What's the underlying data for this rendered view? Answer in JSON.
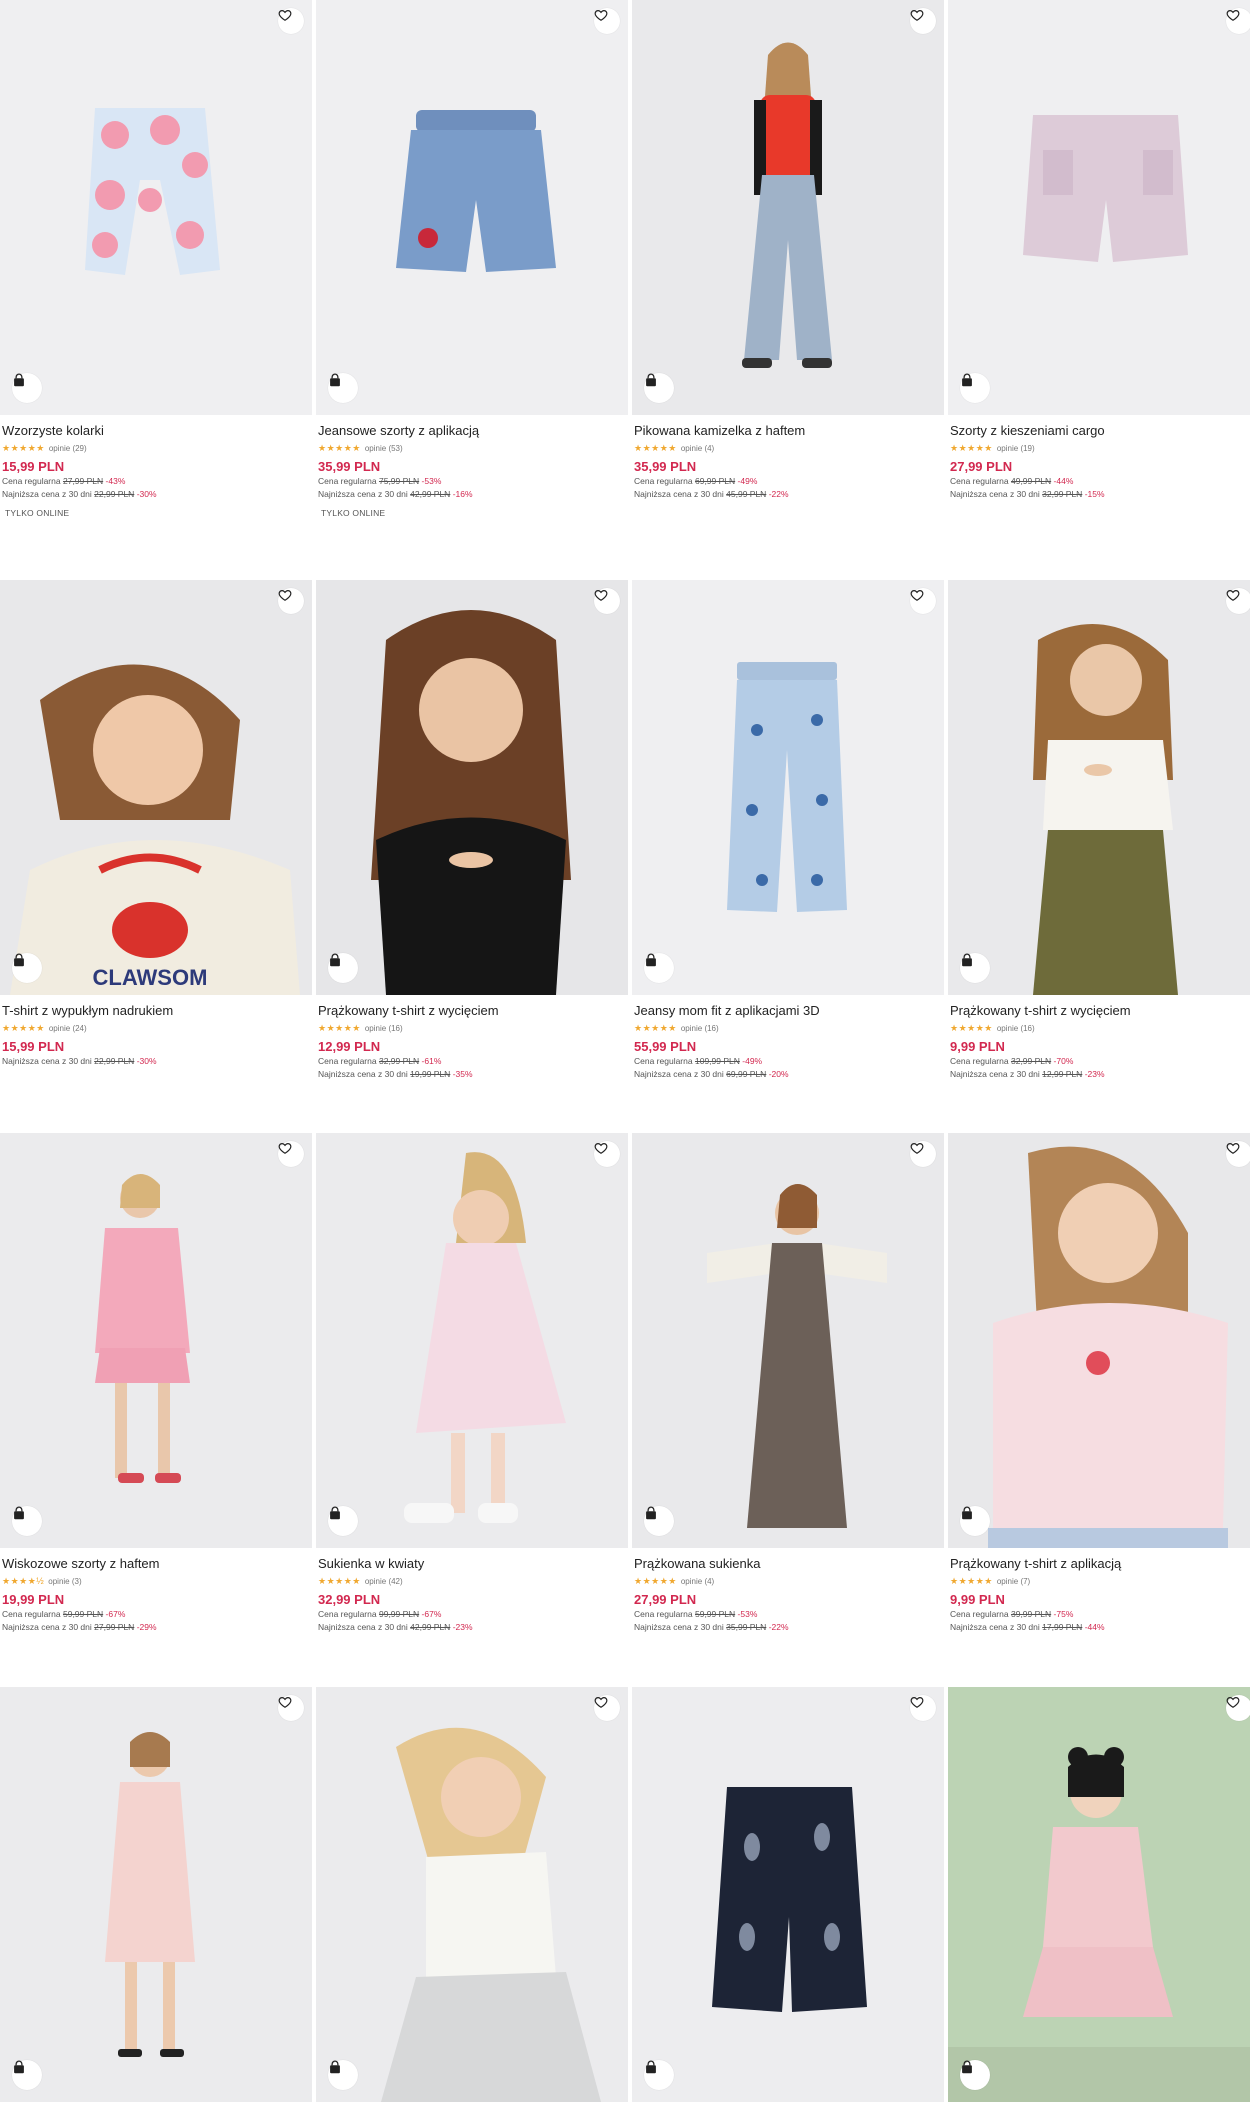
{
  "reviews_prefix": "opinie",
  "products": [
    {
      "title": "Wzorzyste kolarki",
      "stars": "★★★★★",
      "reviews": "(29)",
      "price": "15,99 PLN",
      "regular_label": "Cena regularna",
      "regular_old": "27,99 PLN",
      "regular_disc": "-43%",
      "lowest_label": "Najniższa cena z 30 dni",
      "lowest_old": "22,99 PLN",
      "lowest_disc": "-30%",
      "badge": "TYLKO ONLINE",
      "bg": "#efeff1"
    },
    {
      "title": "Jeansowe szorty z aplikacją",
      "stars": "★★★★★",
      "reviews": "(53)",
      "price": "35,99 PLN",
      "regular_label": "Cena regularna",
      "regular_old": "75,99 PLN",
      "regular_disc": "-53%",
      "lowest_label": "Najniższa cena z 30 dni",
      "lowest_old": "42,99 PLN",
      "lowest_disc": "-16%",
      "badge": "TYLKO ONLINE",
      "bg": "#efeff1"
    },
    {
      "title": "Pikowana kamizelka z haftem",
      "stars": "★★★★★",
      "reviews": "(4)",
      "price": "35,99 PLN",
      "regular_label": "Cena regularna",
      "regular_old": "69,99 PLN",
      "regular_disc": "-49%",
      "lowest_label": "Najniższa cena z 30 dni",
      "lowest_old": "45,99 PLN",
      "lowest_disc": "-22%",
      "badge": "",
      "bg": "#e9e9eb"
    },
    {
      "title": "Szorty z kieszeniami cargo",
      "stars": "★★★★★",
      "reviews": "(19)",
      "price": "27,99 PLN",
      "regular_label": "Cena regularna",
      "regular_old": "49,99 PLN",
      "regular_disc": "-44%",
      "lowest_label": "Najniższa cena z 30 dni",
      "lowest_old": "32,99 PLN",
      "lowest_disc": "-15%",
      "badge": "",
      "bg": "#efeff1"
    },
    {
      "title": "T-shirt z wypukłym nadrukiem",
      "stars": "★★★★★",
      "reviews": "(24)",
      "price": "15,99 PLN",
      "regular_label": "",
      "regular_old": "",
      "regular_disc": "",
      "lowest_label": "Najniższa cena z 30 dni",
      "lowest_old": "22,99 PLN",
      "lowest_disc": "-30%",
      "badge": "",
      "bg": "#e8e8ea"
    },
    {
      "title": "Prążkowany t-shirt z wycięciem",
      "stars": "★★★★★",
      "reviews": "(16)",
      "price": "12,99 PLN",
      "regular_label": "Cena regularna",
      "regular_old": "32,99 PLN",
      "regular_disc": "-61%",
      "lowest_label": "Najniższa cena z 30 dni",
      "lowest_old": "19,99 PLN",
      "lowest_disc": "-35%",
      "badge": "",
      "bg": "#e6e6e8"
    },
    {
      "title": "Jeansy mom fit z aplikacjami 3D",
      "stars": "★★★★★",
      "reviews": "(16)",
      "price": "55,99 PLN",
      "regular_label": "Cena regularna",
      "regular_old": "109,99 PLN",
      "regular_disc": "-49%",
      "lowest_label": "Najniższa cena z 30 dni",
      "lowest_old": "69,99 PLN",
      "lowest_disc": "-20%",
      "badge": "",
      "bg": "#efeff1"
    },
    {
      "title": "Prążkowany t-shirt z wycięciem",
      "stars": "★★★★★",
      "reviews": "(16)",
      "price": "9,99 PLN",
      "regular_label": "Cena regularna",
      "regular_old": "32,99 PLN",
      "regular_disc": "-70%",
      "lowest_label": "Najniższa cena z 30 dni",
      "lowest_old": "12,99 PLN",
      "lowest_disc": "-23%",
      "badge": "",
      "bg": "#e9e9eb"
    },
    {
      "title": "Wiskozowe szorty z haftem",
      "stars": "★★★★½",
      "reviews": "(3)",
      "price": "19,99 PLN",
      "regular_label": "Cena regularna",
      "regular_old": "59,99 PLN",
      "regular_disc": "-67%",
      "lowest_label": "Najniższa cena z 30 dni",
      "lowest_old": "27,99 PLN",
      "lowest_disc": "-29%",
      "badge": "",
      "bg": "#ebebed"
    },
    {
      "title": "Sukienka w kwiaty",
      "stars": "★★★★★",
      "reviews": "(42)",
      "price": "32,99 PLN",
      "regular_label": "Cena regularna",
      "regular_old": "99,99 PLN",
      "regular_disc": "-67%",
      "lowest_label": "Najniższa cena z 30 dni",
      "lowest_old": "42,99 PLN",
      "lowest_disc": "-23%",
      "badge": "",
      "bg": "#ebebed"
    },
    {
      "title": "Prążkowana sukienka",
      "stars": "★★★★★",
      "reviews": "(4)",
      "price": "27,99 PLN",
      "regular_label": "Cena regularna",
      "regular_old": "59,99 PLN",
      "regular_disc": "-53%",
      "lowest_label": "Najniższa cena z 30 dni",
      "lowest_old": "35,99 PLN",
      "lowest_disc": "-22%",
      "badge": "",
      "bg": "#e9e9eb"
    },
    {
      "title": "Prążkowany t-shirt z aplikacją",
      "stars": "★★★★★",
      "reviews": "(7)",
      "price": "9,99 PLN",
      "regular_label": "Cena regularna",
      "regular_old": "39,99 PLN",
      "regular_disc": "-75%",
      "lowest_label": "Najniższa cena z 30 dni",
      "lowest_old": "17,99 PLN",
      "lowest_disc": "-44%",
      "badge": "",
      "bg": "#e8e8ea"
    },
    {
      "title": "",
      "stars": "",
      "reviews": "",
      "price": "",
      "regular_label": "",
      "regular_old": "",
      "regular_disc": "",
      "lowest_label": "",
      "lowest_old": "",
      "lowest_disc": "",
      "badge": "",
      "bg": "#ebebed"
    },
    {
      "title": "",
      "stars": "",
      "reviews": "",
      "price": "",
      "regular_label": "",
      "regular_old": "",
      "regular_disc": "",
      "lowest_label": "",
      "lowest_old": "",
      "lowest_disc": "",
      "badge": "",
      "bg": "#ebebed"
    },
    {
      "title": "",
      "stars": "",
      "reviews": "",
      "price": "",
      "regular_label": "",
      "regular_old": "",
      "regular_disc": "",
      "lowest_label": "",
      "lowest_old": "",
      "lowest_disc": "",
      "badge": "",
      "bg": "#ededef"
    },
    {
      "title": "",
      "stars": "",
      "reviews": "",
      "price": "",
      "regular_label": "",
      "regular_old": "",
      "regular_disc": "",
      "lowest_label": "",
      "lowest_old": "",
      "lowest_disc": "",
      "badge": "",
      "bg": "#bcd3b4"
    }
  ],
  "icons": {
    "favorite": "heart-outline-icon",
    "cart": "shopping-bag-icon"
  },
  "colors": {
    "price_red": "#d2284f",
    "star_gold": "#f0a830"
  }
}
